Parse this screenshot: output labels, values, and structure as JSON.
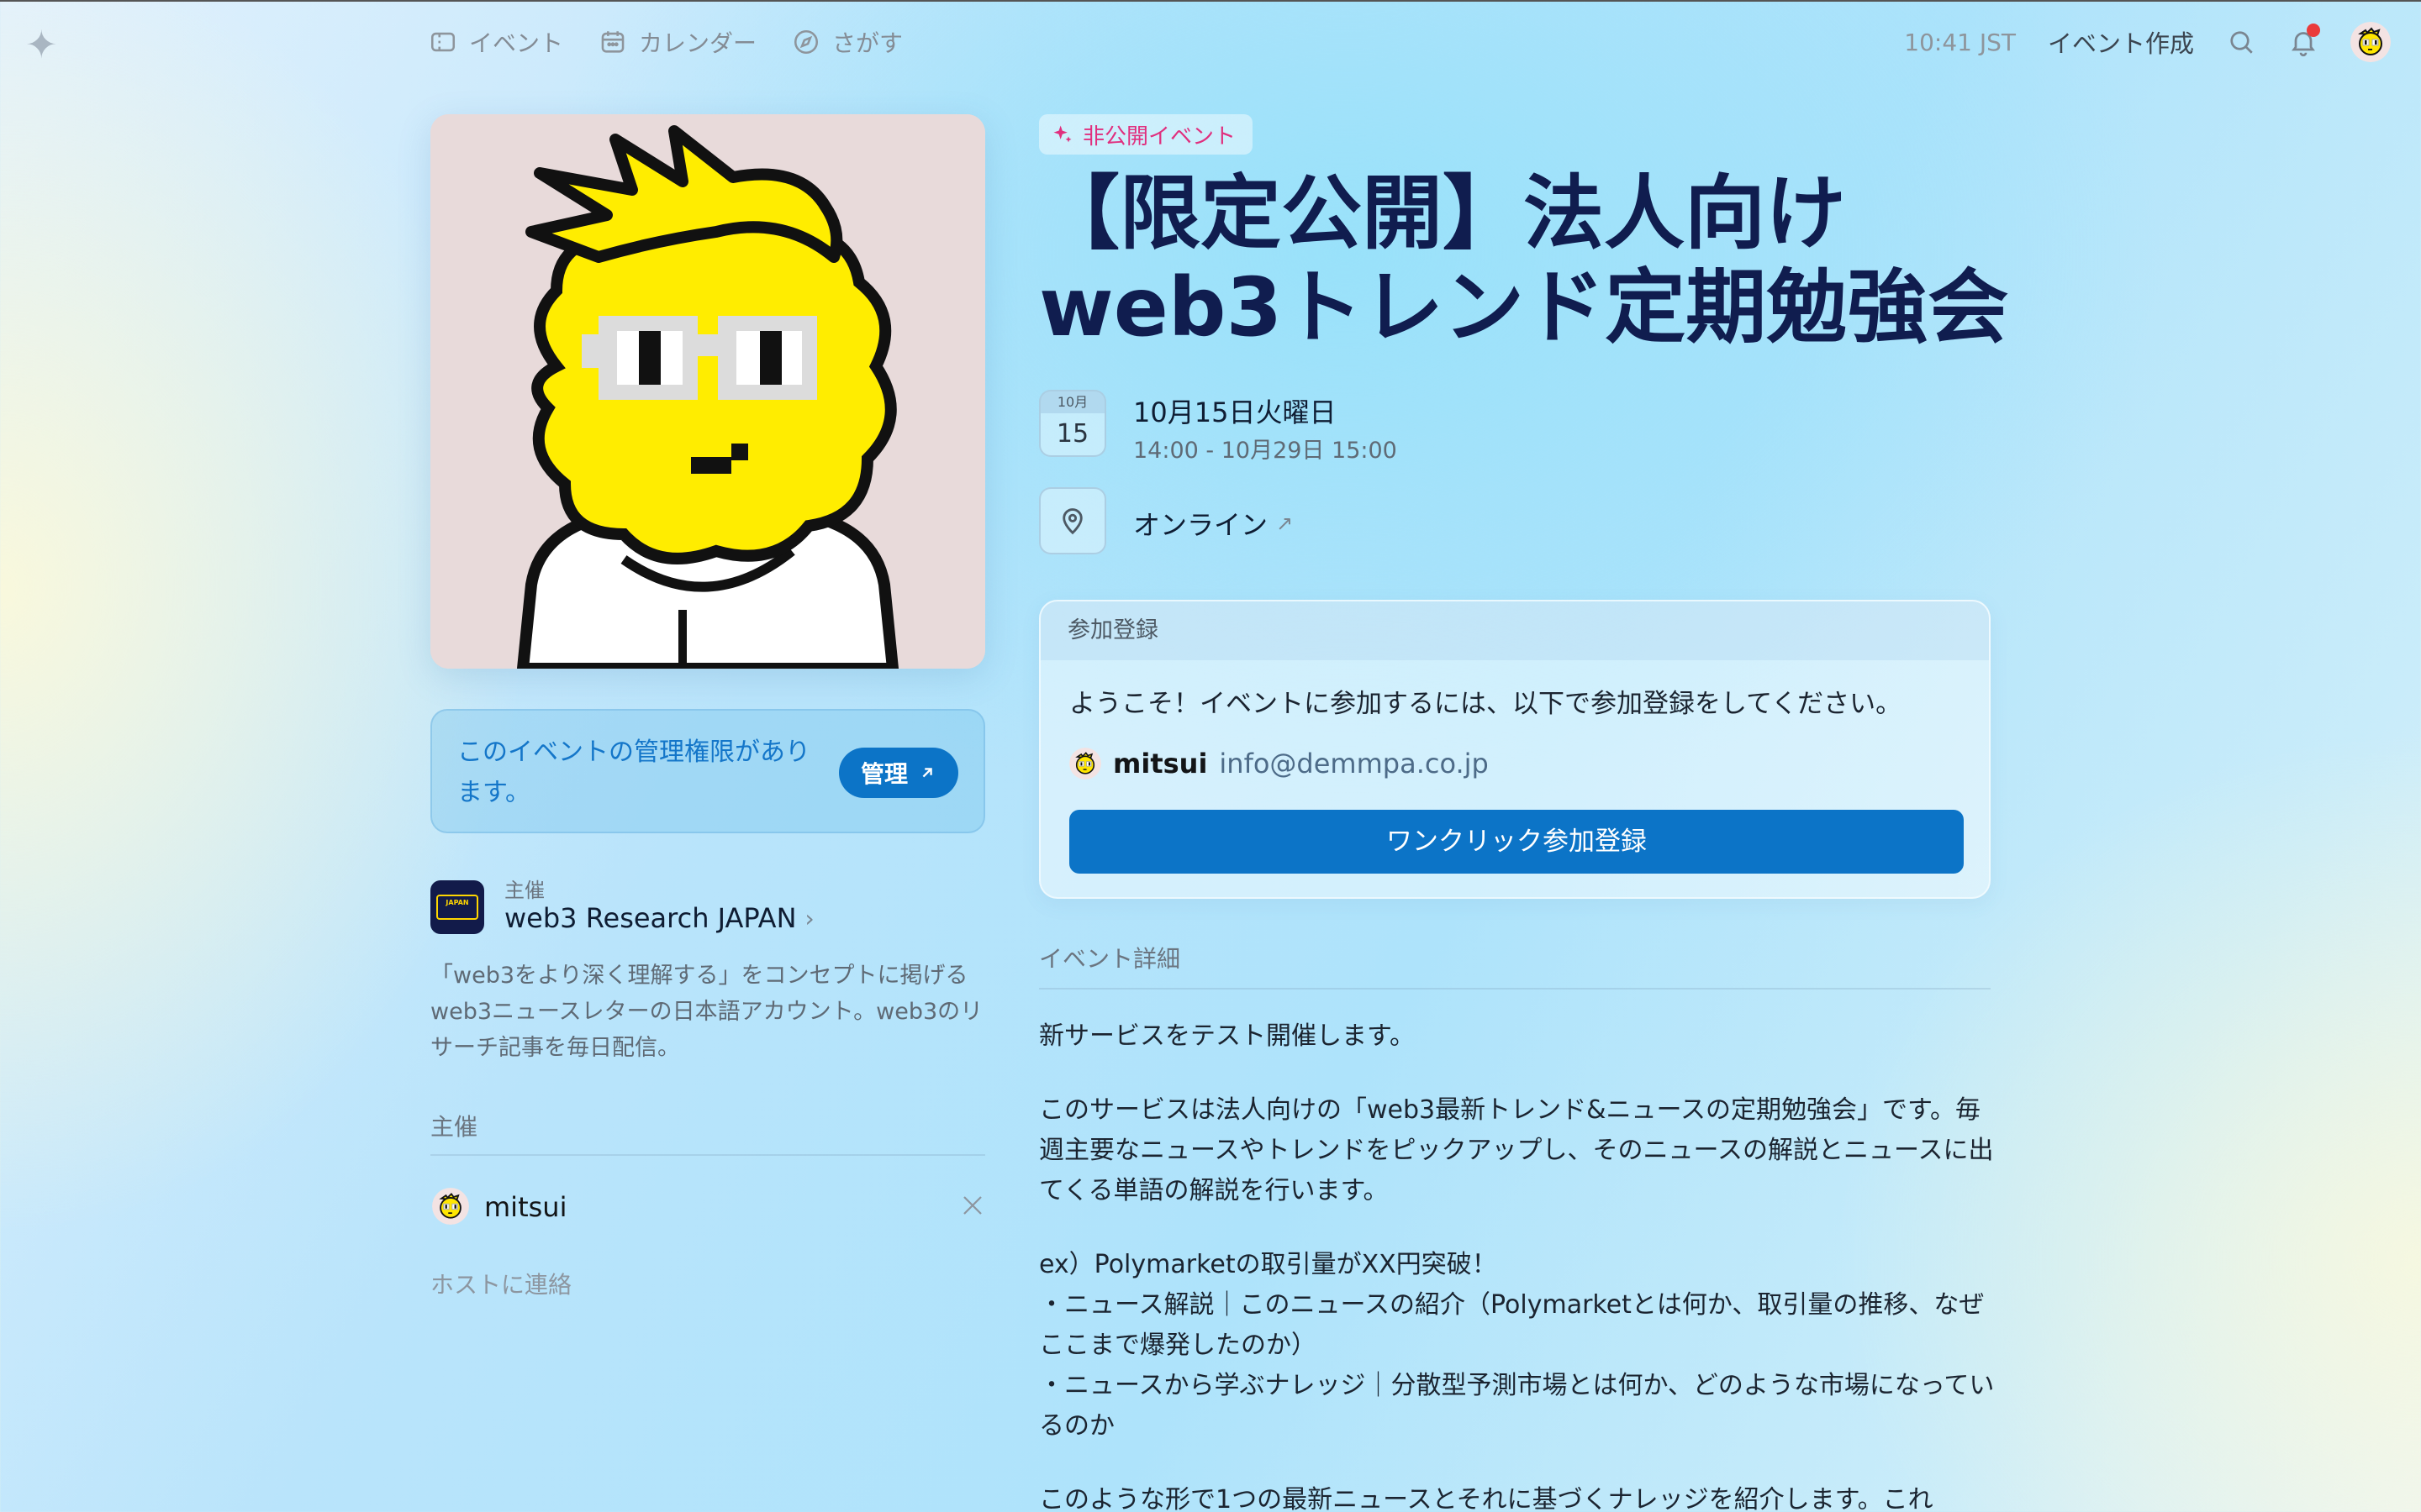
{
  "nav": {
    "logo": "✦",
    "links": [
      {
        "label": "イベント",
        "icon": "ticket-icon"
      },
      {
        "label": "カレンダー",
        "icon": "calendar-icon"
      },
      {
        "label": "さがす",
        "icon": "compass-icon"
      }
    ],
    "time": "10:41 JST",
    "create_event": "イベント作成"
  },
  "manage": {
    "text": "このイベントの管理権限があります。",
    "button": "管理"
  },
  "organizer": {
    "label": "主催",
    "name": "web3 Research JAPAN",
    "logo_text": "JAPAN",
    "description": "「web3をより深く理解する」をコンセプトに掲げるweb3ニュースレターの日本語アカウント。web3のリサーチ記事を毎日配信。"
  },
  "hosts": {
    "title": "主催",
    "items": [
      {
        "name": "mitsui"
      }
    ],
    "contact": "ホストに連絡"
  },
  "event": {
    "badge": "非公開イベント",
    "title_line1": "【限定公開】法人向け",
    "title_line2": "web3トレンド定期勉強会",
    "cal_month": "10月",
    "cal_day": "15",
    "date": "10月15日火曜日",
    "time_range": "14:00 - 10月29日 15:00",
    "location": "オンライン"
  },
  "registration": {
    "header": "参加登録",
    "welcome": "ようこそ！イベントに参加するには、以下で参加登録をしてください。",
    "user_name": "mitsui",
    "user_email": "info@demmpa.co.jp",
    "button": "ワンクリック参加登録"
  },
  "details": {
    "title": "イベント詳細",
    "p1": "新サービスをテスト開催します。",
    "p2": "このサービスは法人向けの「web3最新トレンド&ニュースの定期勉強会」です。毎週主要なニュースやトレンドをピックアップし、そのニュースの解説とニュースに出てくる単語の解説を行います。",
    "p3a": "ex）Polymarketの取引量がXX円突破！",
    "p3b": "・ニュース解説｜このニュースの紹介（Polymarketとは何か、取引量の推移、なぜここまで爆発したのか）",
    "p3c": "・ニュースから学ぶナレッジ｜分散型予測市場とは何か、どのような市場になっているのか",
    "p4": "このような形で1つの最新ニュースとそれに基づくナレッジを紹介します。これ"
  },
  "colors": {
    "accent": "#0c74c7",
    "title": "#101d4f",
    "badge": "#e02f7e"
  }
}
